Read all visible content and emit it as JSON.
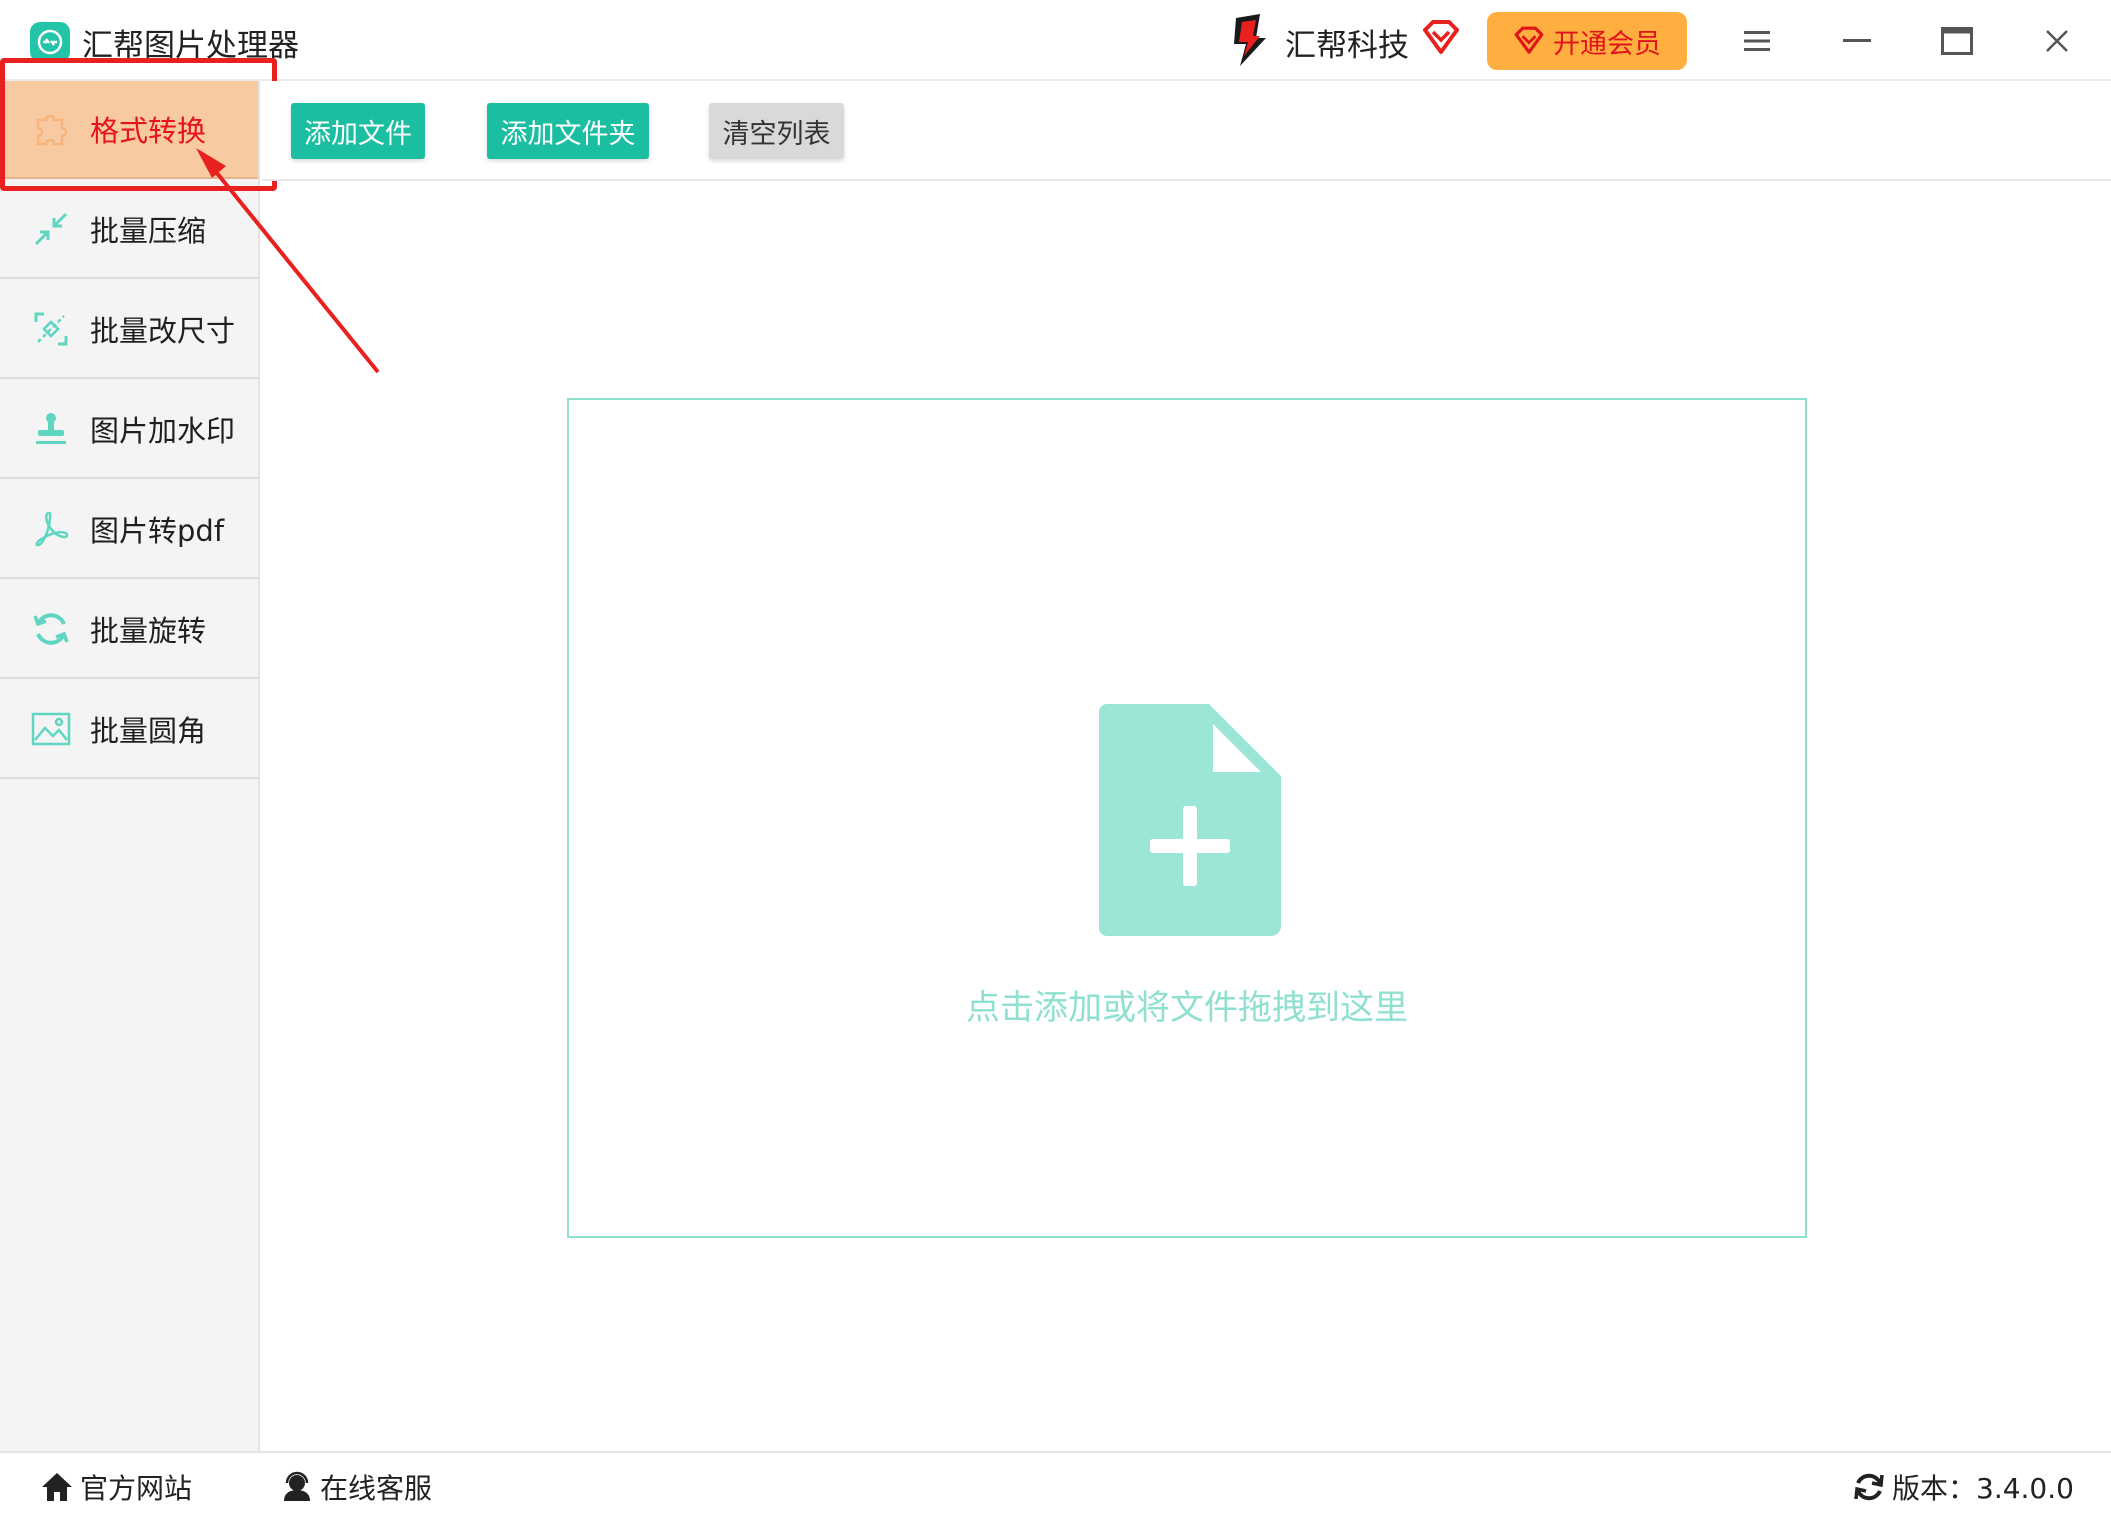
{
  "app": {
    "title": "汇帮图片处理器"
  },
  "header": {
    "brand_name": "汇帮科技",
    "vip_label": "开通会员",
    "accent_color": "#1cbea1",
    "vip_color": "#ffaf3f",
    "vip_text_color": "#e2141b"
  },
  "sidebar": {
    "items": [
      {
        "label": "格式转换",
        "icon": "puzzle-icon",
        "active": true
      },
      {
        "label": "批量压缩",
        "icon": "compress-icon"
      },
      {
        "label": "批量改尺寸",
        "icon": "resize-icon"
      },
      {
        "label": "图片加水印",
        "icon": "stamp-icon"
      },
      {
        "label": "图片转pdf",
        "icon": "pdf-icon"
      },
      {
        "label": "批量旋转",
        "icon": "rotate-icon"
      },
      {
        "label": "批量圆角",
        "icon": "image-icon"
      }
    ],
    "active_bg": "#f8caa1",
    "active_text_color": "#e8121a"
  },
  "toolbar": {
    "add_file": "添加文件",
    "add_folder": "添加文件夹",
    "clear_list": "清空列表"
  },
  "dropzone": {
    "hint": "点击添加或将文件拖拽到这里",
    "icon": "file-add-icon",
    "color": "#8fe0d0"
  },
  "statusbar": {
    "website": "官方网站",
    "support": "在线客服",
    "version": "版本：3.4.0.0"
  }
}
